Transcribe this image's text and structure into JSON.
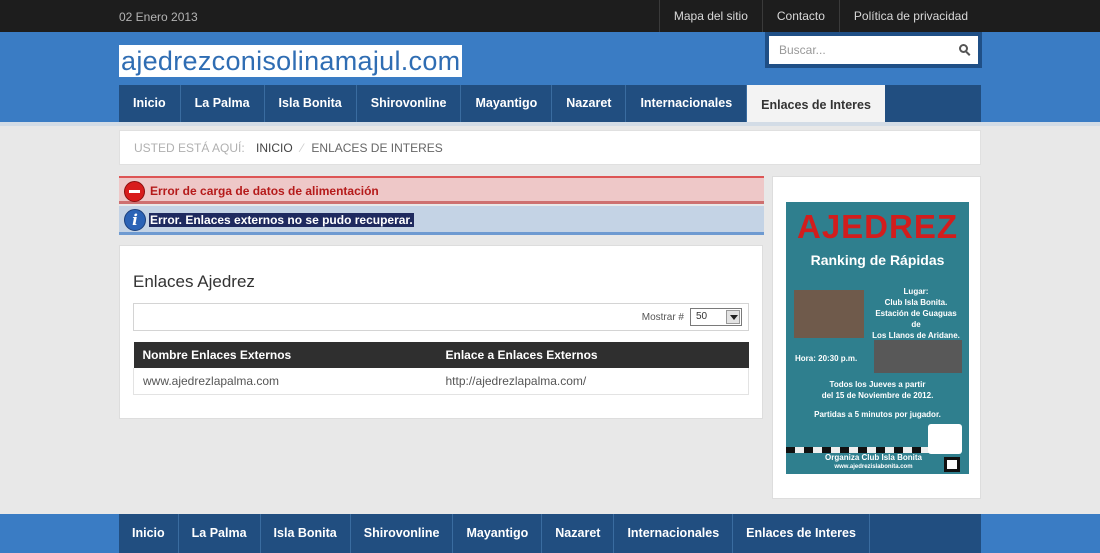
{
  "topbar": {
    "date": "02 Enero 2013",
    "links": [
      "Mapa del sitio",
      "Contacto",
      "Política de privacidad"
    ]
  },
  "header": {
    "site_title": "ajedrezconisolinamajul.com",
    "search_placeholder": "Buscar..."
  },
  "nav": {
    "items": [
      "Inicio",
      "La Palma",
      "Isla Bonita",
      "Shirovonline",
      "Mayantigo",
      "Nazaret",
      "Internacionales",
      "Enlaces de Interes"
    ],
    "active": "Enlaces de Interes"
  },
  "breadcrumb": {
    "lead": "Usted está aquí:",
    "home": "Inicio",
    "separator": "⁄",
    "current": "Enlaces de Interes"
  },
  "alerts": {
    "error": "Error de carga de datos de alimentación",
    "info": "Error. Enlaces externos no se pudo recuperar."
  },
  "main": {
    "heading": "Enlaces Ajedrez",
    "display_label": "Mostrar #",
    "display_value": "50",
    "table": {
      "headers": [
        "Nombre Enlaces Externos",
        "Enlace a Enlaces Externos"
      ],
      "rows": [
        [
          "www.ajedrezlapalma.com",
          "http://ajedrezlapalma.com/"
        ]
      ]
    }
  },
  "poster": {
    "title": "AJEDREZ",
    "subtitle": "Ranking de Rápidas",
    "lugar": [
      "Lugar:",
      "Club Isla Bonita.",
      "Estación de Guaguas",
      "de",
      "Los Llanos de Aridane."
    ],
    "hora": "Hora: 20:30 p.m.",
    "jueves": [
      "Todos los Jueves a partir",
      "del 15 de Noviembre de 2012."
    ],
    "partidas": "Partidas a 5 minutos por jugador.",
    "organiza": [
      "Organiza Club Isla Bonita",
      "www.ajedrezislabonita.com"
    ]
  },
  "footer": {
    "items": [
      "Inicio",
      "La Palma",
      "Isla Bonita",
      "Shirovonline",
      "Mayantigo",
      "Nazaret",
      "Internacionales",
      "Enlaces de Interes"
    ]
  },
  "colors": {
    "header_blue": "#3a7cc4",
    "nav_dark_blue": "#214e80",
    "error_red": "#b51a1a",
    "info_blue": "#2b63b6"
  }
}
